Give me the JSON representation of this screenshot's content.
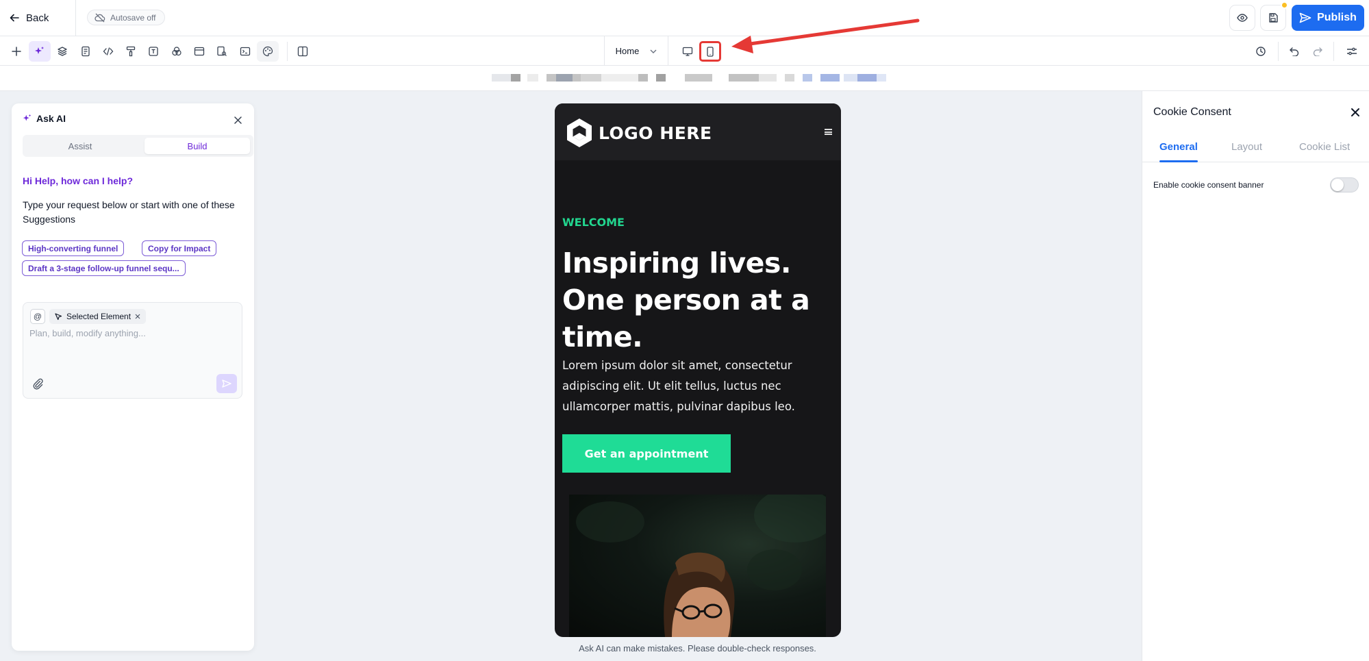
{
  "topbar": {
    "back_label": "Back",
    "autosave_label": "Autosave off",
    "publish_label": "Publish"
  },
  "toolbar": {
    "page_select": "Home"
  },
  "ai_panel": {
    "title": "Ask AI",
    "tabs": [
      "Assist",
      "Build"
    ],
    "active_tab": "Build",
    "greeting": "Hi Help, how can I help?",
    "intro": "Type your request below or start with one of these Suggestions",
    "suggestions": [
      "High-converting funnel",
      "Copy for Impact",
      "Draft a 3-stage follow-up funnel sequ..."
    ],
    "selected_chip": "Selected Element",
    "input_placeholder": "Plan, build, modify anything..."
  },
  "preview": {
    "logo_text": "LOGO HERE",
    "welcome": "WELCOME",
    "headline_line1": "Inspiring lives.",
    "headline_line2": "One person at a",
    "headline_line3": "time.",
    "body_line1": "Lorem ipsum dolor sit amet, consectetur",
    "body_line2": "adipiscing elit. Ut elit tellus, luctus nec",
    "body_line3": "ullamcorper mattis, pulvinar dapibus leo.",
    "cta_label": "Get an appointment"
  },
  "disclaimer": "Ask AI can make mistakes. Please double-check responses.",
  "settings_panel": {
    "title": "Cookie Consent",
    "tabs": [
      "General",
      "Layout",
      "Cookie List"
    ],
    "active_tab": "General",
    "toggle_label": "Enable cookie consent banner",
    "toggle_on": false
  },
  "colors": {
    "accent_purple": "#6d28d9",
    "publish_blue": "#1d6cf0",
    "cta_green": "#1fdc96",
    "annotation_red": "#e53935"
  }
}
